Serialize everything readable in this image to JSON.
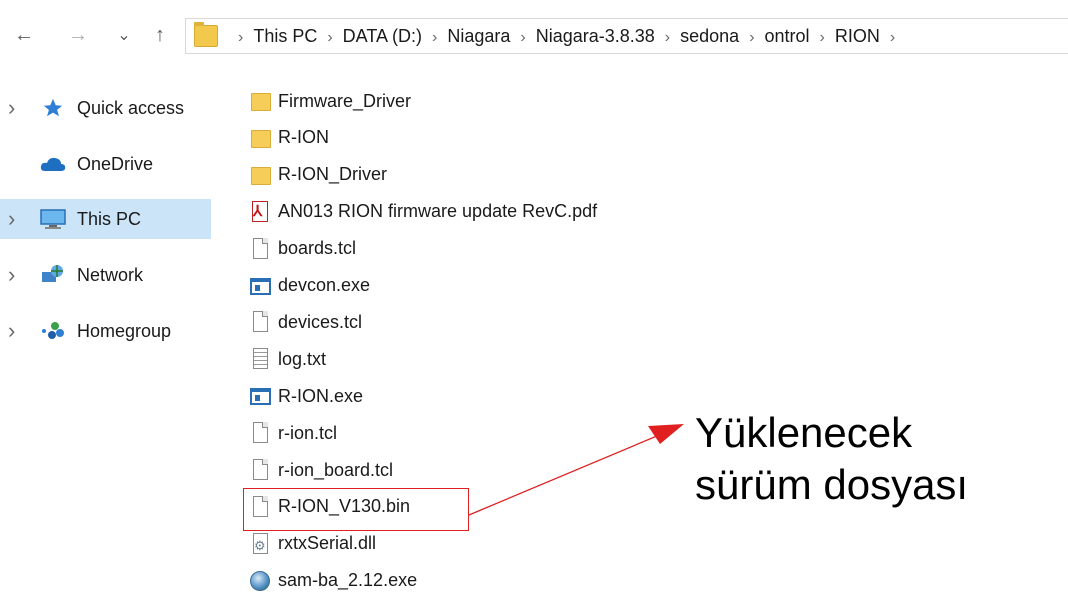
{
  "toolbar": {
    "back_glyph": "←",
    "forward_glyph": "→",
    "recent_glyph": "⌄",
    "up_glyph": "↑"
  },
  "breadcrumb": {
    "separator": "›",
    "items": [
      "This PC",
      "DATA (D:)",
      "Niagara",
      "Niagara-3.8.38",
      "sedona",
      "ontrol",
      "RION"
    ]
  },
  "nav": {
    "items": [
      {
        "label": "Quick access",
        "icon": "star-icon",
        "expandable": true
      },
      {
        "label": "OneDrive",
        "icon": "cloud-icon",
        "expandable": false
      },
      {
        "label": "This PC",
        "icon": "monitor-icon",
        "expandable": true,
        "selected": true
      },
      {
        "label": "Network",
        "icon": "network-icon",
        "expandable": true
      },
      {
        "label": "Homegroup",
        "icon": "homegroup-icon",
        "expandable": true
      }
    ]
  },
  "files": [
    {
      "name": "Firmware_Driver",
      "type": "folder"
    },
    {
      "name": "R-ION",
      "type": "folder"
    },
    {
      "name": "R-ION_Driver",
      "type": "folder"
    },
    {
      "name": "AN013 RION firmware update RevC.pdf",
      "type": "pdf"
    },
    {
      "name": "boards.tcl",
      "type": "doc"
    },
    {
      "name": "devcon.exe",
      "type": "exe"
    },
    {
      "name": "devices.tcl",
      "type": "doc"
    },
    {
      "name": "log.txt",
      "type": "txt"
    },
    {
      "name": "R-ION.exe",
      "type": "exe"
    },
    {
      "name": "r-ion.tcl",
      "type": "doc"
    },
    {
      "name": "r-ion_board.tcl",
      "type": "doc"
    },
    {
      "name": "R-ION_V130.bin",
      "type": "doc"
    },
    {
      "name": "rxtxSerial.dll",
      "type": "dll"
    },
    {
      "name": "sam-ba_2.12.exe",
      "type": "app"
    }
  ],
  "annotation": {
    "line1": "Yüklenecek",
    "line2": "sürüm dosyası",
    "color": "#e02020"
  }
}
